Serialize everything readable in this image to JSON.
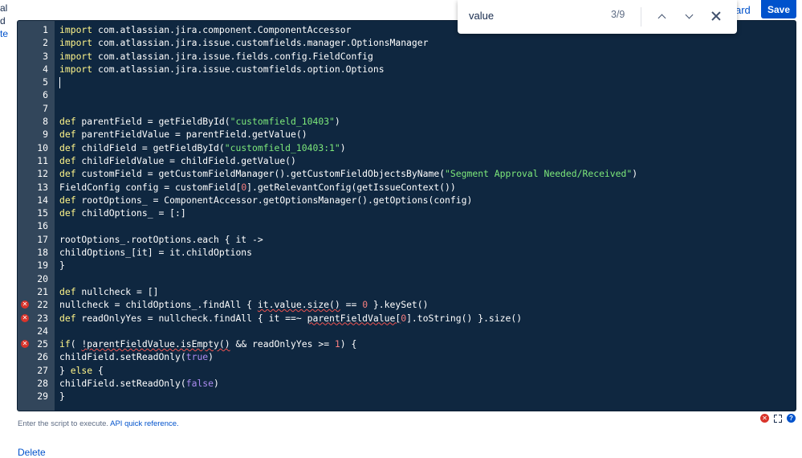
{
  "left_cut": {
    "line1": "al",
    "line2": "d",
    "line3": "te"
  },
  "header": {
    "board_link": "ard",
    "save_label": "Save"
  },
  "find": {
    "query": "value",
    "placeholder": "",
    "count": "3/9"
  },
  "editor": {
    "lines": [
      {
        "n": "1",
        "error": false,
        "tokens": [
          {
            "t": "import",
            "c": "kw"
          },
          {
            "t": " com.atlassian.jira.component.ComponentAccessor"
          }
        ]
      },
      {
        "n": "2",
        "error": false,
        "tokens": [
          {
            "t": "import",
            "c": "kw"
          },
          {
            "t": " com.atlassian.jira.issue.customfields.manager.OptionsManager"
          }
        ]
      },
      {
        "n": "3",
        "error": false,
        "tokens": [
          {
            "t": "import",
            "c": "kw"
          },
          {
            "t": " com.atlassian.jira.issue.fields.config.FieldConfig"
          }
        ]
      },
      {
        "n": "4",
        "error": false,
        "tokens": [
          {
            "t": "import",
            "c": "kw"
          },
          {
            "t": " com.atlassian.jira.issue.customfields.option.Options"
          }
        ]
      },
      {
        "n": "5",
        "error": false,
        "caret": true,
        "tokens": []
      },
      {
        "n": "6",
        "error": false,
        "tokens": []
      },
      {
        "n": "7",
        "error": false,
        "tokens": []
      },
      {
        "n": "8",
        "error": false,
        "tokens": [
          {
            "t": "def",
            "c": "kw"
          },
          {
            "t": " parentField = getFieldById("
          },
          {
            "t": "\"customfield_10403\"",
            "c": "str"
          },
          {
            "t": ")"
          }
        ]
      },
      {
        "n": "9",
        "error": false,
        "tokens": [
          {
            "t": "def",
            "c": "kw"
          },
          {
            "t": " parentFieldValue = parentField.getValue()"
          }
        ]
      },
      {
        "n": "10",
        "error": false,
        "tokens": [
          {
            "t": "def",
            "c": "kw"
          },
          {
            "t": " childField = getFieldById("
          },
          {
            "t": "\"customfield_10403:1\"",
            "c": "str"
          },
          {
            "t": ")"
          }
        ]
      },
      {
        "n": "11",
        "error": false,
        "tokens": [
          {
            "t": "def",
            "c": "kw"
          },
          {
            "t": " childFieldValue = childField.getValue()"
          }
        ]
      },
      {
        "n": "12",
        "error": false,
        "tokens": [
          {
            "t": "def",
            "c": "kw"
          },
          {
            "t": " customField = getCustomFieldManager().getCustomFieldObjectsByName("
          },
          {
            "t": "\"Segment Approval Needed/Received\"",
            "c": "str"
          },
          {
            "t": ")"
          }
        ]
      },
      {
        "n": "13",
        "error": false,
        "tokens": [
          {
            "t": "FieldConfig config = customField["
          },
          {
            "t": "0",
            "c": "num"
          },
          {
            "t": "].getRelevantConfig(getIssueContext())"
          }
        ]
      },
      {
        "n": "14",
        "error": false,
        "tokens": [
          {
            "t": "def",
            "c": "kw"
          },
          {
            "t": " rootOptions_ = ComponentAccessor.getOptionsManager().getOptions(config)"
          }
        ]
      },
      {
        "n": "15",
        "error": false,
        "tokens": [
          {
            "t": "def",
            "c": "kw"
          },
          {
            "t": " childOptions_ = [:]"
          }
        ]
      },
      {
        "n": "16",
        "error": false,
        "tokens": []
      },
      {
        "n": "17",
        "error": false,
        "tokens": [
          {
            "t": "rootOptions_.rootOptions.each { it ->"
          }
        ]
      },
      {
        "n": "18",
        "error": false,
        "tokens": [
          {
            "t": "childOptions_[it] = it.childOptions"
          }
        ]
      },
      {
        "n": "19",
        "error": false,
        "tokens": [
          {
            "t": "}"
          }
        ]
      },
      {
        "n": "20",
        "error": false,
        "tokens": []
      },
      {
        "n": "21",
        "error": false,
        "tokens": [
          {
            "t": "def",
            "c": "kw"
          },
          {
            "t": " nullcheck = []"
          }
        ]
      },
      {
        "n": "22",
        "error": true,
        "tokens": [
          {
            "t": "nullcheck = childOptions_.findAll { "
          },
          {
            "t": "it.value.size()",
            "c": "squig"
          },
          {
            "t": " == "
          },
          {
            "t": "0",
            "c": "num"
          },
          {
            "t": " }.keySet()"
          }
        ]
      },
      {
        "n": "23",
        "error": true,
        "tokens": [
          {
            "t": "def",
            "c": "kw"
          },
          {
            "t": " readOnlyYes = nullcheck.findAll { it ==~ "
          },
          {
            "t": "parentFieldValue[",
            "c": "squig"
          },
          {
            "t": "0",
            "c": "num"
          },
          {
            "t": "].toString() }.size()"
          }
        ]
      },
      {
        "n": "24",
        "error": false,
        "tokens": []
      },
      {
        "n": "25",
        "error": true,
        "tokens": [
          {
            "t": "if",
            "c": "kw"
          },
          {
            "t": "( "
          },
          {
            "t": "!parentFieldValue.isEmpty()",
            "c": "squig"
          },
          {
            "t": " && readOnlyYes >= "
          },
          {
            "t": "1",
            "c": "num"
          },
          {
            "t": ") {"
          }
        ]
      },
      {
        "n": "26",
        "error": false,
        "tokens": [
          {
            "t": "childField.setReadOnly("
          },
          {
            "t": "true",
            "c": "lit"
          },
          {
            "t": ")"
          }
        ]
      },
      {
        "n": "27",
        "error": false,
        "tokens": [
          {
            "t": "} "
          },
          {
            "t": "else",
            "c": "kw"
          },
          {
            "t": " {"
          }
        ]
      },
      {
        "n": "28",
        "error": false,
        "tokens": [
          {
            "t": "childField.setReadOnly("
          },
          {
            "t": "false",
            "c": "lit"
          },
          {
            "t": ")"
          }
        ]
      },
      {
        "n": "29",
        "error": false,
        "tokens": [
          {
            "t": "}"
          }
        ]
      }
    ]
  },
  "help": {
    "text": "Enter the script to execute. ",
    "link": "API quick reference."
  },
  "bottom_cut_link": "Delete",
  "icons": {
    "error": "error-icon",
    "fullscreen": "fullscreen-icon",
    "help": "help-icon"
  }
}
